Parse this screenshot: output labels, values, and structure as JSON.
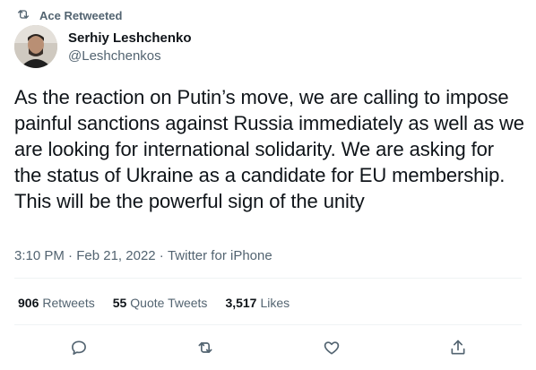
{
  "retweet": {
    "label": "Ace Retweeted",
    "icon": "retweet-icon"
  },
  "author": {
    "name": "Serhiy Leshchenko",
    "handle": "@Leshchenkos"
  },
  "tweet": {
    "text": "As the reaction on Putin’s move, we are calling to impose painful sanctions against Russia immediately as well as we are looking for international solidarity. We are asking for the status of Ukraine as a candidate for EU membership. This will be the powerful sign of the unity"
  },
  "meta": {
    "time": "3:10 PM",
    "date": "Feb 21, 2022",
    "source": "Twitter for iPhone",
    "separator": " · "
  },
  "stats": {
    "retweets_count": "906",
    "retweets_label": "Retweets",
    "quotes_count": "55",
    "quotes_label": "Quote Tweets",
    "likes_count": "3,517",
    "likes_label": "Likes"
  },
  "actions": [
    "reply-icon",
    "retweet-icon",
    "like-icon",
    "share-icon"
  ],
  "colors": {
    "text": "#0f1419",
    "secondary": "#536471",
    "divider": "#eff3f4"
  }
}
